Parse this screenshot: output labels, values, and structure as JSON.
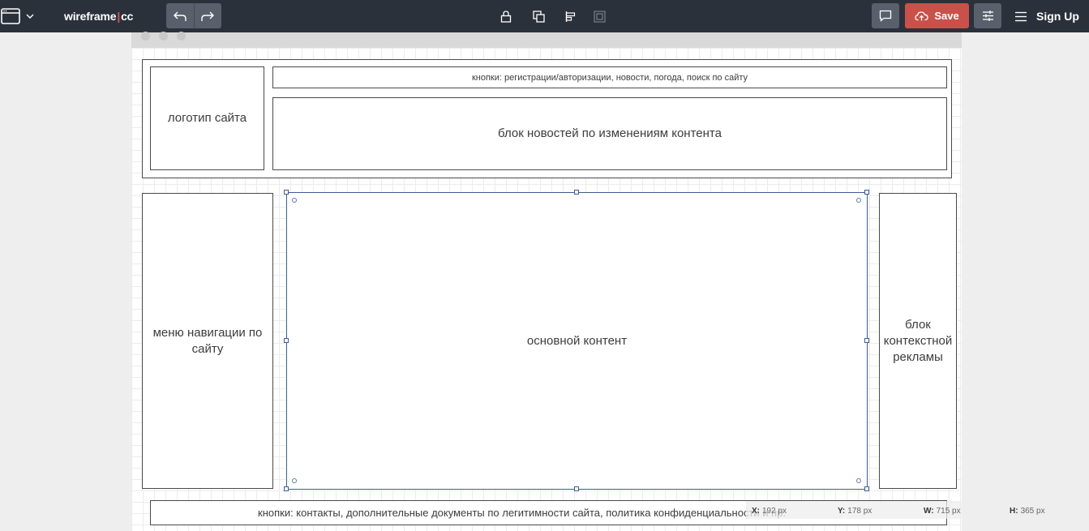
{
  "app": {
    "brand_left": "wireframe",
    "brand_sep": "|",
    "brand_right": "cc"
  },
  "toolbar": {
    "save_label": "Save",
    "signup_label": "Sign Up",
    "icons": [
      "window-icon",
      "chevron-down-icon",
      "undo-icon",
      "redo-icon",
      "lock-icon",
      "duplicate-icon",
      "align-icon",
      "layer-icon",
      "comment-icon",
      "cloud-upload-icon",
      "sliders-icon",
      "menu-icon"
    ]
  },
  "wireframe": {
    "logo": "логотип сайта",
    "top_buttons": "кнопки: регистрации/авторизации, новости, погода, поиск по сайту",
    "news_block": "блок новостей по изменениям контента",
    "nav_menu": "меню навигации по сайту",
    "main_content": "основной контент",
    "ads_block": "блок контекстной рекламы",
    "footer_buttons": "кнопки: контакты, дополнительные документы по легитимности сайта, политика конфиденциальности и пр."
  },
  "status": {
    "x_label": "X:",
    "x_value": "192 px",
    "y_label": "Y:",
    "y_value": "178 px",
    "w_label": "W:",
    "w_value": "715 px",
    "h_label": "H:",
    "h_value": "365 px"
  },
  "colors": {
    "topbar": "#2b313b",
    "save": "#c9514a",
    "selection": "#3d5d93"
  }
}
